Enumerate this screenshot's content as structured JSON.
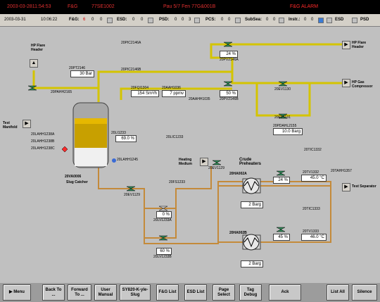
{
  "alarm_bar": {
    "timestamp": "2003-03-2811:54:53",
    "system": "F&G",
    "tag": "77SE1002",
    "message": "Pau 5/7 Fen 77G&001B",
    "alarm_type": "F&G ALARM"
  },
  "status_bar": {
    "date": "2003-03-31",
    "time": "10:06:22",
    "fg_label": "F&G:",
    "fg_values": [
      "6",
      "0",
      "0"
    ],
    "esd_label": "ESD:",
    "esd_values": [
      "0",
      "0"
    ],
    "psd_label": "PSD:",
    "psd_values": [
      "0",
      "0",
      "3"
    ],
    "pcs_label": "PCS:",
    "pcs_values": [
      "0",
      "0"
    ],
    "subsea_label": "SubSea:",
    "subsea_values": [
      "0",
      "0"
    ],
    "instr_label": "Instr.:",
    "instr_values": [
      "0",
      "0"
    ],
    "esd_ind": "ESD",
    "psd_ind": "PSD"
  },
  "process": {
    "hp_flare_header_left": "HP Flare Header",
    "hp_flare_header_right": "HP Flare Header",
    "hp_gas_compressor": "HP Gas Compressor",
    "test_manifold": "Test Manifold",
    "heating_medium": "Heating Medium",
    "crude_preheaters": "Crude Preheaters",
    "test_separator": "Test Separator",
    "vessel_tag": "20VA0006",
    "vessel_name": "Slug Catcher",
    "pt2146": "20PT2146",
    "pt2146_val": "30 Bar",
    "pic2146a": "20PIC2146A",
    "pic2146b": "20PIC2146B",
    "pv2146a": "20PV2146A",
    "pv2146a_pct": "24 %",
    "pv2146b": "20PV2146B",
    "pv2146b_pct": "50 %",
    "pahh2165": "20PAHH2165",
    "fqi1304": "20FQI1304",
    "fqi1304_val": "154 Sm³/h",
    "aah1036": "20AAH1036",
    "aah1036_val": "7 ppmv",
    "aahh1035": "20AAHH1035",
    "ev1130": "20EV1130",
    "ev1131": "20EV1131",
    "pdahl2155": "20PDAHL2155",
    "pdahl2155_val": "10.0 Barg",
    "lahh1238a": "20LAHH1238A",
    "lahh1238b": "20LAHH1238B",
    "lahh1238c": "20LAHH1238C",
    "li1233": "20LI1233",
    "li1233_val": "69.0 %",
    "lic1233": "20LIC1233",
    "lahh1245": "20LAHH1245",
    "ev1129": "20EV1129",
    "fs1233": "20FS1233",
    "lv1233a": "20LV1233A",
    "lv1233a_pct": "0 %",
    "lv1233b": "20LV1233B",
    "lv1233b_pct": "60 %",
    "ev1129b": "20EV1129",
    "ha002a": "20HA002A",
    "ha002b": "20HA002B",
    "ha002a_press": "2 Barg",
    "ha002b_press": "2 Barg",
    "tic1332": "20TIC1332",
    "tv1332": "20TV1332",
    "tv1332_pct": "24 %",
    "ti1332_val": "45.0 °C",
    "tahh1357": "20TAHH1357",
    "tic1333": "20TIC1333",
    "tv1333": "20TV1333",
    "tv1333_pct": "45 %",
    "ti1333_val": "46.0 °C"
  },
  "menu": {
    "menu": "Menu",
    "back": "Back To ...",
    "forward": "Forward To ...",
    "user_manual": "User Manual",
    "sy820": "SY820-K-yle-Slug",
    "fg_list": "F&G List",
    "esd_list": "ESD List",
    "page_select": "Page Select",
    "tag_debug": "Tag Debug",
    "ack": "Ack",
    "list_all": "List All",
    "silence": "Silence"
  },
  "colors": {
    "gas_line": "#d4c400",
    "liquid_line": "#c48a3a",
    "valve_green": "#2e8b57",
    "vessel_oil": "#c8a000",
    "vessel_gas": "#e6b800",
    "alarm_red": "#ff2a2a"
  }
}
